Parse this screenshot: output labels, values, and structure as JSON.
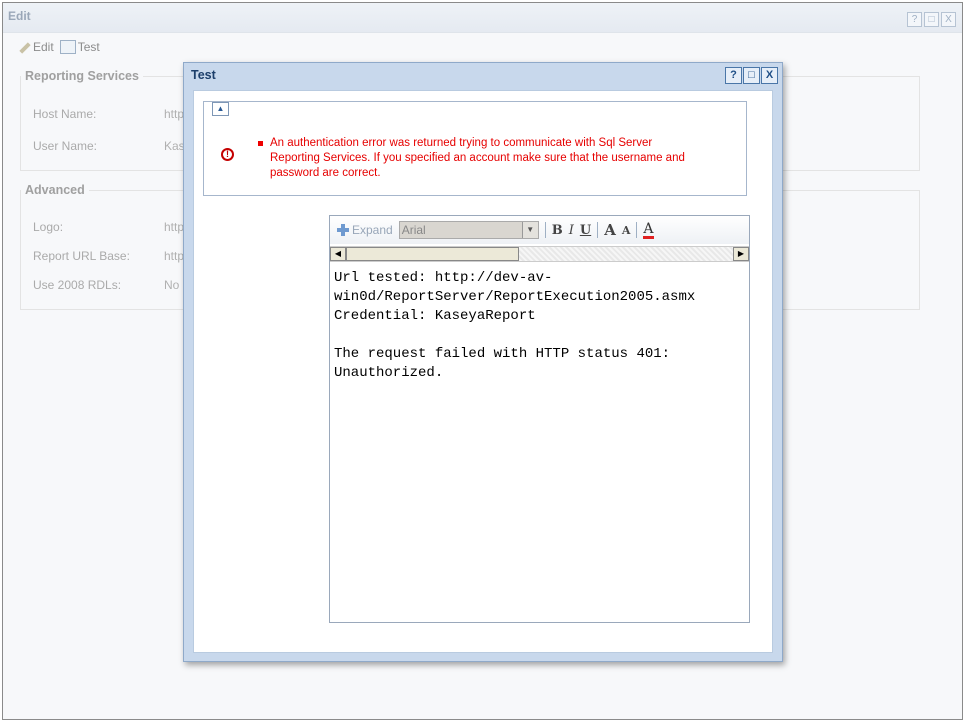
{
  "window": {
    "title": "Edit",
    "buttons": [
      "?",
      "□",
      "X"
    ]
  },
  "toolbar": {
    "edit_label": "Edit",
    "test_label": "Test"
  },
  "reporting_services": {
    "legend": "Reporting Services",
    "host_name_label": "Host Name:",
    "host_name_value": "http",
    "user_name_label": "User Name:",
    "user_name_value": "Kas"
  },
  "advanced": {
    "legend": "Advanced",
    "logo_label": "Logo:",
    "logo_value": "http",
    "report_url_label": "Report URL Base:",
    "report_url_value": "http",
    "use_2008_label": "Use 2008 RDLs:",
    "use_2008_value": "No"
  },
  "modal": {
    "title": "Test",
    "buttons": [
      "?",
      "□",
      "X"
    ],
    "error_message": "An authentication error was returned trying to communicate with Sql Server Reporting Services. If you specified an account make sure that the username and password are correct.",
    "editor": {
      "expand_label": "Expand",
      "font_value": "Arial",
      "bold_label": "B",
      "italic_label": "I",
      "underline_label": "U",
      "grow_font_label": "A",
      "shrink_font_label": "A",
      "font_color_label": "A",
      "lines": [
        "Url tested: http://dev-av-",
        "win0d/ReportServer/ReportExecution2005.asmx",
        "Credential: KaseyaReport",
        "",
        "The request failed with HTTP status 401:",
        "Unauthorized."
      ]
    }
  },
  "colors": {
    "error_red": "#e60000",
    "modal_title": "#1d3f6b",
    "modal_frame": "#c8d8ec"
  }
}
